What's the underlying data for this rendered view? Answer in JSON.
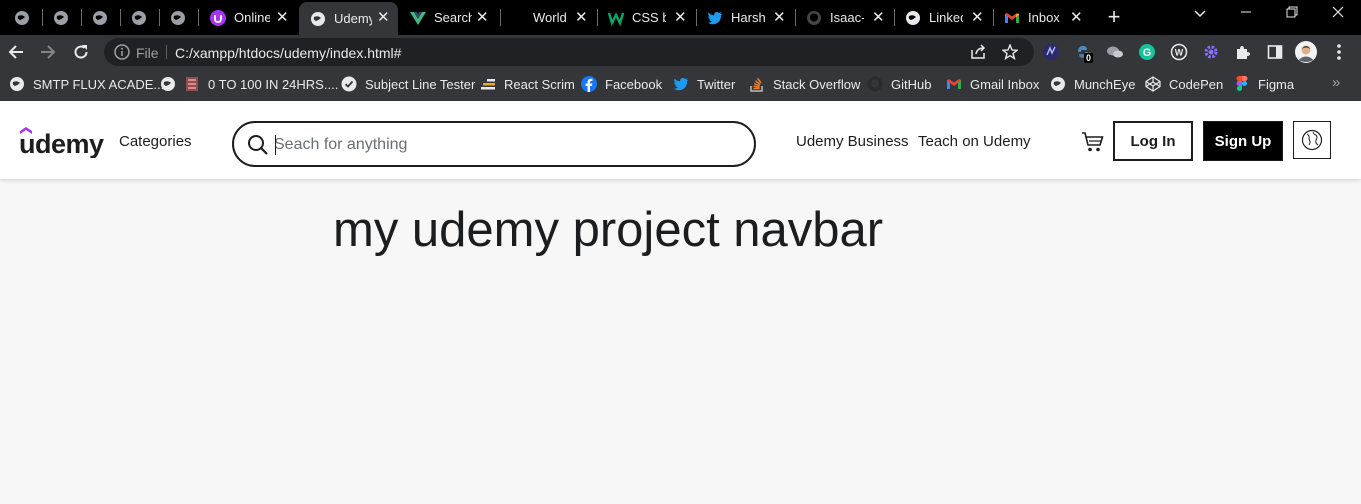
{
  "browser": {
    "tabs": [
      {
        "title": "",
        "icon": "globe-icon",
        "active": false
      },
      {
        "title": "",
        "icon": "globe-icon",
        "active": false
      },
      {
        "title": "",
        "icon": "globe-icon",
        "active": false
      },
      {
        "title": "",
        "icon": "globe-icon",
        "active": false
      },
      {
        "title": "",
        "icon": "globe-icon",
        "active": false
      },
      {
        "title": "Online",
        "icon": "udemy-icon",
        "active": false
      },
      {
        "title": "Udemy",
        "icon": "globe-icon",
        "active": true
      },
      {
        "title": "Search",
        "icon": "vue-icon",
        "active": false
      },
      {
        "title": "World",
        "icon": "",
        "active": false
      },
      {
        "title": "CSS bo",
        "icon": "w-icon",
        "active": false
      },
      {
        "title": "Harsh",
        "icon": "twitter-icon",
        "active": false
      },
      {
        "title": "Isaac-I",
        "icon": "github-icon",
        "active": false
      },
      {
        "title": "Linked",
        "icon": "globe-icon",
        "active": false
      },
      {
        "title": "Inbox",
        "icon": "gmail-icon",
        "active": false
      }
    ],
    "omnibox": {
      "scheme_label": "File",
      "url": "C:/xampp/htdocs/udemy/index.html#"
    },
    "extension_badge": "0",
    "bookmarks": [
      {
        "label": "SMTP FLUX ACADE...",
        "icon": "globe-icon"
      },
      {
        "label": "0 TO 100 IN 24HRS....",
        "icon": "globe-icon"
      },
      {
        "label": "Subject Line Tester",
        "icon": "check-circle-icon"
      },
      {
        "label": "React Scrim",
        "icon": "scrimba-icon"
      },
      {
        "label": "Facebook",
        "icon": "facebook-icon"
      },
      {
        "label": "Twitter",
        "icon": "twitter-icon"
      },
      {
        "label": "Stack Overflow",
        "icon": "stackoverflow-icon"
      },
      {
        "label": "GitHub",
        "icon": "github-icon"
      },
      {
        "label": "Gmail Inbox",
        "icon": "gmail-icon"
      },
      {
        "label": "MunchEye",
        "icon": "globe-icon"
      },
      {
        "label": "CodePen",
        "icon": "codepen-icon"
      },
      {
        "label": "Figma",
        "icon": "figma-icon"
      }
    ],
    "colors": {
      "tabstrip": "#000000",
      "toolbar": "#35363a",
      "omnibox": "#202124",
      "text": "#e8eaed"
    }
  },
  "navbar": {
    "logo_text": "udemy",
    "categories_label": "Categories",
    "search_placeholder": "Seach for anything",
    "business_label": "Udemy Business",
    "teach_label": "Teach on Udemy",
    "login_label": "Log In",
    "signup_label": "Sign Up",
    "brand_color": "#a435f0"
  },
  "main": {
    "heading": "my udemy project navbar"
  }
}
